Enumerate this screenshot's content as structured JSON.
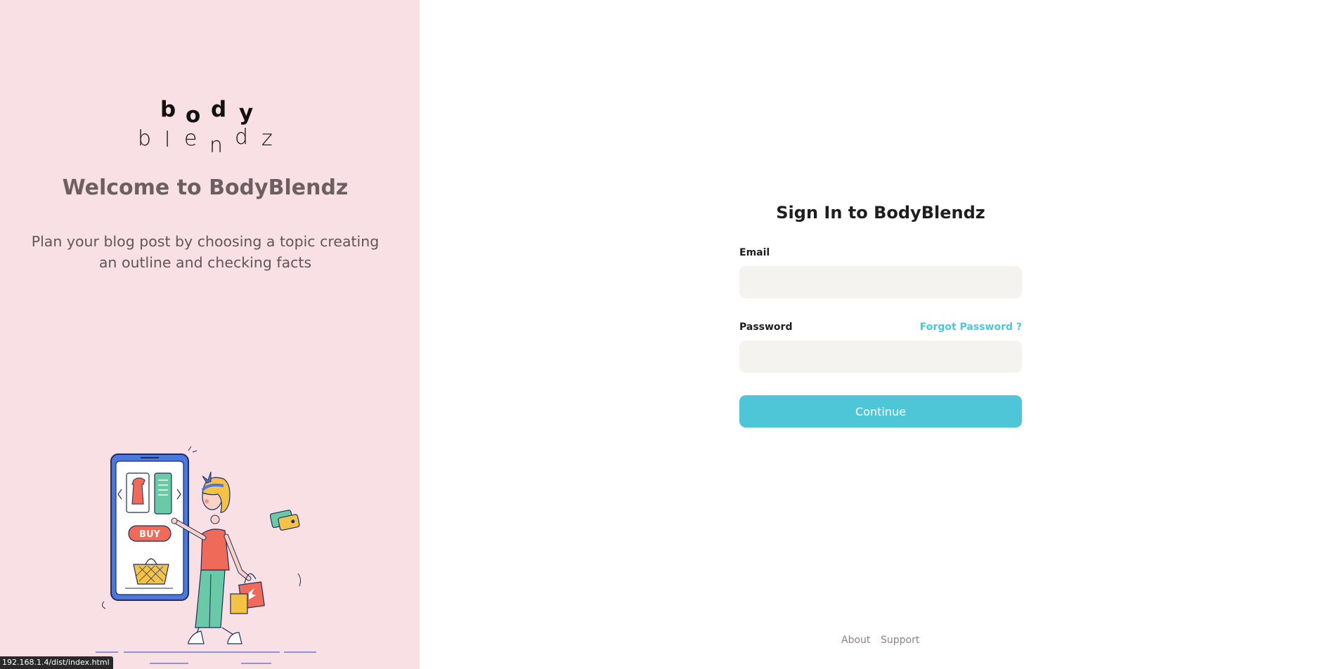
{
  "brand": {
    "logo_line1": [
      "b",
      "o",
      "d",
      "y"
    ],
    "logo_line2": [
      "b",
      "l",
      "e",
      "n",
      "d",
      "z"
    ]
  },
  "left": {
    "welcome": "Welcome to BodyBlendz",
    "tagline": "Plan your blog post by choosing a topic creating an outline and checking facts",
    "illustration_buy_label": "BUY"
  },
  "signin": {
    "title": "Sign In to BodyBlendz",
    "email_label": "Email",
    "email_value": "",
    "password_label": "Password",
    "password_value": "",
    "forgot_link": "Forgot Password ?",
    "continue_label": "Continue"
  },
  "footer": {
    "about": "About",
    "support": "Support"
  },
  "status_bar": {
    "url": "192.168.1.4/dist/index.html"
  },
  "colors": {
    "left_panel_bg": "#f9e0e5",
    "accent": "#4fc6d8",
    "input_bg": "#f5f3f0",
    "heading_muted": "#6c5f62"
  }
}
